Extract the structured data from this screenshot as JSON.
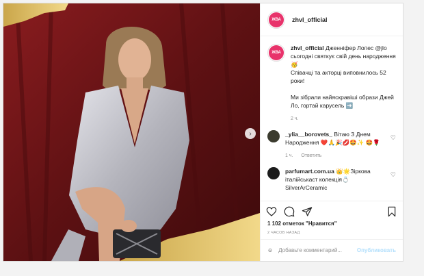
{
  "account": {
    "username": "zhvl_official",
    "avatar_text": "ЖВА"
  },
  "caption": {
    "username": "zhvl_official",
    "line1": "Дженніфер Лопес @jlo сьогодні святкує свій день народження🥳",
    "line2": "Співачці та акторці виповнилось 52 роки!",
    "line3": "Ми зібрали найяскравіші образи Джей Ло, гортай карусель ➡️",
    "time": "2 ч."
  },
  "comments": [
    {
      "username": "_ylia__borovets_",
      "text": "Вітаю З Днем Народження ❤️🙏🎉💋🤩✨ 🤩🌹",
      "time": "1 ч.",
      "reply": "Ответить"
    },
    {
      "username": "parfumart.com.ua",
      "text": "👑🌟Зіркова італійськаст колекція💍 SilverArCeramic",
      "time": "",
      "reply": ""
    }
  ],
  "likes_text": "1 102 отметок \"Нравится\"",
  "time_ago": "2 ЧАСОВ НАЗАД",
  "add_comment_placeholder": "Добавьте комментарий...",
  "publish_label": "Опубликовать",
  "colors": {
    "brand": "#e8336b",
    "curtain": "#6b1416",
    "dress": "#c9c9cf"
  }
}
